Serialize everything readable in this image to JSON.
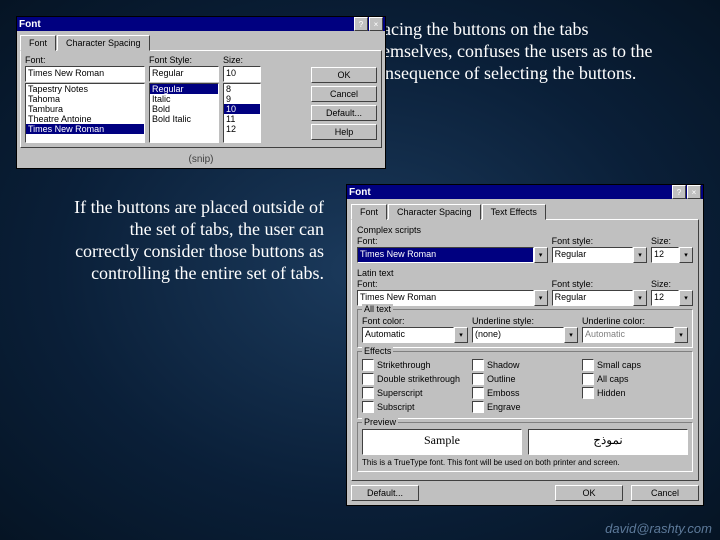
{
  "captions": {
    "right": "Placing the buttons on the tabs themselves, confuses the users as to the consequence of selecting the buttons.",
    "left": "If the buttons are placed outside of the set of tabs, the user can correctly consider those buttons as controlling the entire set of tabs."
  },
  "dialog1": {
    "title": "Font",
    "tabs": [
      "Font",
      "Character Spacing"
    ],
    "labels": {
      "font": "Font:",
      "style": "Font Style:",
      "size": "Size:"
    },
    "font_value": "Times New Roman",
    "style_value": "Regular",
    "size_value": "10",
    "font_list": [
      "Tapestry Notes",
      "Tahoma",
      "Tambura",
      "Theatre Antoine",
      "Times New Roman"
    ],
    "style_list": [
      "Regular",
      "Italic",
      "Bold",
      "Bold Italic"
    ],
    "size_list": [
      "8",
      "9",
      "10",
      "11",
      "12"
    ],
    "buttons": {
      "ok": "OK",
      "cancel": "Cancel",
      "default": "Default...",
      "help": "Help"
    },
    "snip": "(snip)"
  },
  "dialog2": {
    "title": "Font",
    "tabs": [
      "Font",
      "Character Spacing",
      "Text Effects"
    ],
    "complex_label": "Complex scripts",
    "latin_label": "Latin text",
    "labels": {
      "font": "Font:",
      "style": "Font style:",
      "size": "Size:"
    },
    "font_value": "Times New Roman",
    "style_value": "Regular",
    "size_value": "12",
    "latin_font": "Times New Roman",
    "latin_style": "Regular",
    "latin_size": "12",
    "alltext_label": "All text",
    "color_label": "Font color:",
    "color_value": "Automatic",
    "underline_label": "Underline style:",
    "underline_value": "(none)",
    "ucolor_label": "Underline color:",
    "ucolor_value": "Automatic",
    "effects_label": "Effects",
    "effects": {
      "strike": "Strikethrough",
      "dblstrike": "Double strikethrough",
      "super": "Superscript",
      "sub": "Subscript",
      "shadow": "Shadow",
      "outline": "Outline",
      "emboss": "Emboss",
      "engrave": "Engrave",
      "smallcaps": "Small caps",
      "allcaps": "All caps",
      "hidden": "Hidden"
    },
    "preview_label": "Preview",
    "preview_left": "Sample",
    "preview_right": "نموذج",
    "hint": "This is a TrueType font. This font will be used on both printer and screen.",
    "buttons": {
      "default": "Default...",
      "ok": "OK",
      "cancel": "Cancel"
    }
  },
  "footer": "david@rashty.com"
}
